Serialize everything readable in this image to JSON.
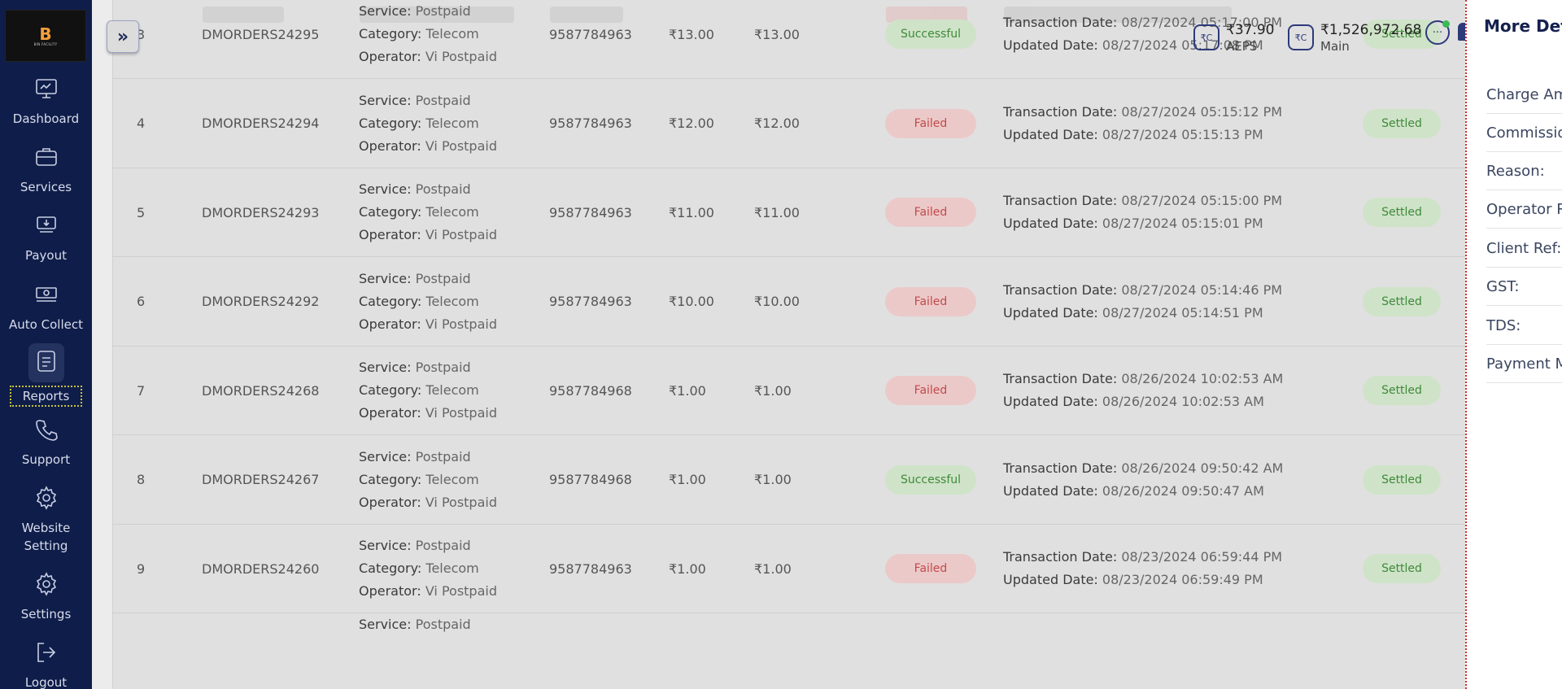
{
  "sidebar": {
    "items": [
      {
        "label": "Dashboard"
      },
      {
        "label": "Services"
      },
      {
        "label": "Payout"
      },
      {
        "label": "Auto Collect"
      },
      {
        "label": "Reports"
      },
      {
        "label": "Support"
      },
      {
        "label": "Website Setting"
      },
      {
        "label": "Settings"
      },
      {
        "label": "Logout"
      }
    ]
  },
  "header": {
    "toggle_label": "»",
    "aeps_amount": "₹37.90",
    "aeps_label": "AEPS",
    "main_amount": "₹1,526,972.68",
    "main_label": "Main",
    "wallet_icon": "₹C"
  },
  "labels": {
    "service": "Service:",
    "category": "Category:",
    "operator": "Operator:",
    "transaction_date": "Transaction Date:",
    "updated_date": "Updated Date:"
  },
  "rows": [
    {
      "num": "3",
      "order": "DMORDERS24295",
      "service": "Postpaid",
      "category": "Telecom",
      "operator": "Vi Postpaid",
      "phone": "9587784963",
      "amount": "₹13.00",
      "net": "₹13.00",
      "status": "Successful",
      "txn_date": "08/27/2024 05:17:00 PM",
      "upd_date": "08/27/2024 05:17:08 PM",
      "settle": "Settled"
    },
    {
      "num": "4",
      "order": "DMORDERS24294",
      "service": "Postpaid",
      "category": "Telecom",
      "operator": "Vi Postpaid",
      "phone": "9587784963",
      "amount": "₹12.00",
      "net": "₹12.00",
      "status": "Failed",
      "txn_date": "08/27/2024 05:15:12 PM",
      "upd_date": "08/27/2024 05:15:13 PM",
      "settle": "Settled"
    },
    {
      "num": "5",
      "order": "DMORDERS24293",
      "service": "Postpaid",
      "category": "Telecom",
      "operator": "Vi Postpaid",
      "phone": "9587784963",
      "amount": "₹11.00",
      "net": "₹11.00",
      "status": "Failed",
      "txn_date": "08/27/2024 05:15:00 PM",
      "upd_date": "08/27/2024 05:15:01 PM",
      "settle": "Settled"
    },
    {
      "num": "6",
      "order": "DMORDERS24292",
      "service": "Postpaid",
      "category": "Telecom",
      "operator": "Vi Postpaid",
      "phone": "9587784963",
      "amount": "₹10.00",
      "net": "₹10.00",
      "status": "Failed",
      "txn_date": "08/27/2024 05:14:46 PM",
      "upd_date": "08/27/2024 05:14:51 PM",
      "settle": "Settled"
    },
    {
      "num": "7",
      "order": "DMORDERS24268",
      "service": "Postpaid",
      "category": "Telecom",
      "operator": "Vi Postpaid",
      "phone": "9587784968",
      "amount": "₹1.00",
      "net": "₹1.00",
      "status": "Failed",
      "txn_date": "08/26/2024 10:02:53 AM",
      "upd_date": "08/26/2024 10:02:53 AM",
      "settle": "Settled"
    },
    {
      "num": "8",
      "order": "DMORDERS24267",
      "service": "Postpaid",
      "category": "Telecom",
      "operator": "Vi Postpaid",
      "phone": "9587784968",
      "amount": "₹1.00",
      "net": "₹1.00",
      "status": "Successful",
      "txn_date": "08/26/2024 09:50:42 AM",
      "upd_date": "08/26/2024 09:50:47 AM",
      "settle": "Settled"
    },
    {
      "num": "9",
      "order": "DMORDERS24260",
      "service": "Postpaid",
      "category": "Telecom",
      "operator": "Vi Postpaid",
      "phone": "9587784963",
      "amount": "₹1.00",
      "net": "₹1.00",
      "status": "Failed",
      "txn_date": "08/23/2024 06:59:44 PM",
      "upd_date": "08/23/2024 06:59:49 PM",
      "settle": "Settled"
    }
  ],
  "partial_row": {
    "service_label": "Service:",
    "service": "Postpaid"
  },
  "drawer": {
    "title": "More Details",
    "fields": [
      {
        "label": "Charge Amount"
      },
      {
        "label": "Commission"
      },
      {
        "label": "Reason:"
      },
      {
        "label": "Operator Ref"
      },
      {
        "label": "Client Ref:"
      },
      {
        "label": "GST:"
      },
      {
        "label": "TDS:"
      },
      {
        "label": "Payment Mode"
      }
    ]
  },
  "colors": {
    "sidebar": "#0f1d4a",
    "success": "#3f8a3a",
    "failed": "#c24a4a",
    "accent": "#14204d"
  }
}
